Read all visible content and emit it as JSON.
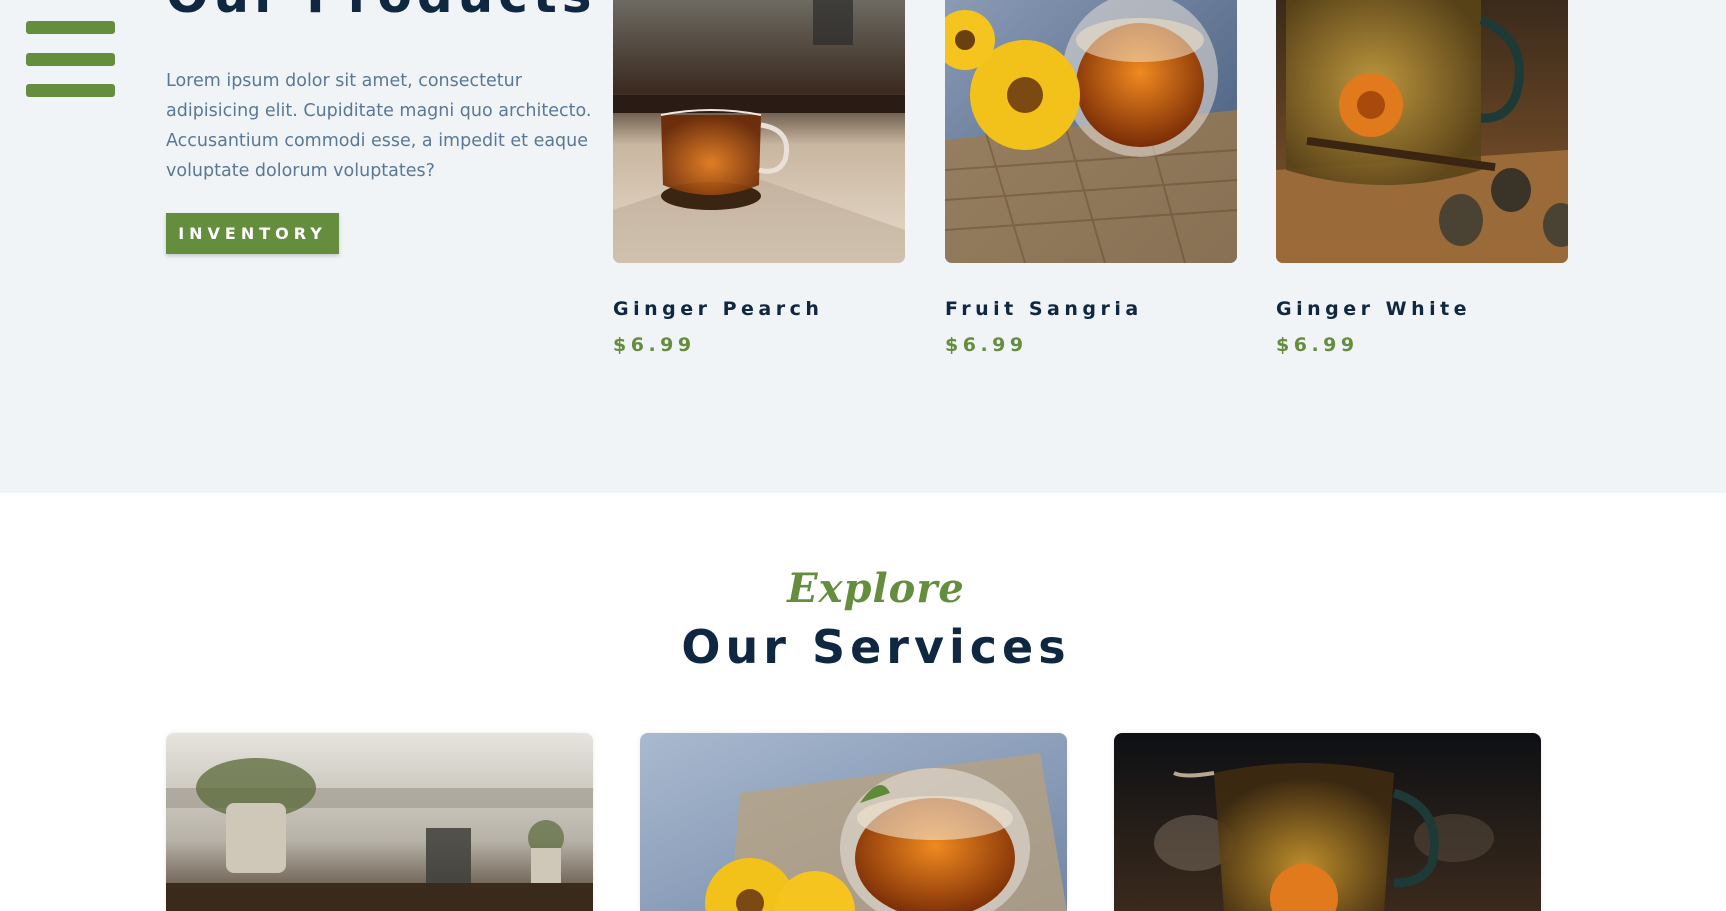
{
  "colors": {
    "accent": "#658d3e",
    "heading": "#0f2740",
    "body_text": "#5a7896",
    "section_bg": "#f0f4f7"
  },
  "nav": {
    "menu_icon": "hamburger-menu-icon"
  },
  "products": {
    "title": "Our Products",
    "description": "Lorem ipsum dolor sit amet, consectetur adipisicing elit. Cupiditate magni quo architecto. Accusantium commodi esse, a impedit et eaque voluptate dolorum voluptates?",
    "button_label": "INVENTORY",
    "items": [
      {
        "name": "Ginger Pearch",
        "price": "$6.99"
      },
      {
        "name": "Fruit Sangria",
        "price": "$6.99"
      },
      {
        "name": "Ginger White",
        "price": "$6.99"
      }
    ]
  },
  "services": {
    "script_label": "Explore",
    "title": "Our Services"
  }
}
